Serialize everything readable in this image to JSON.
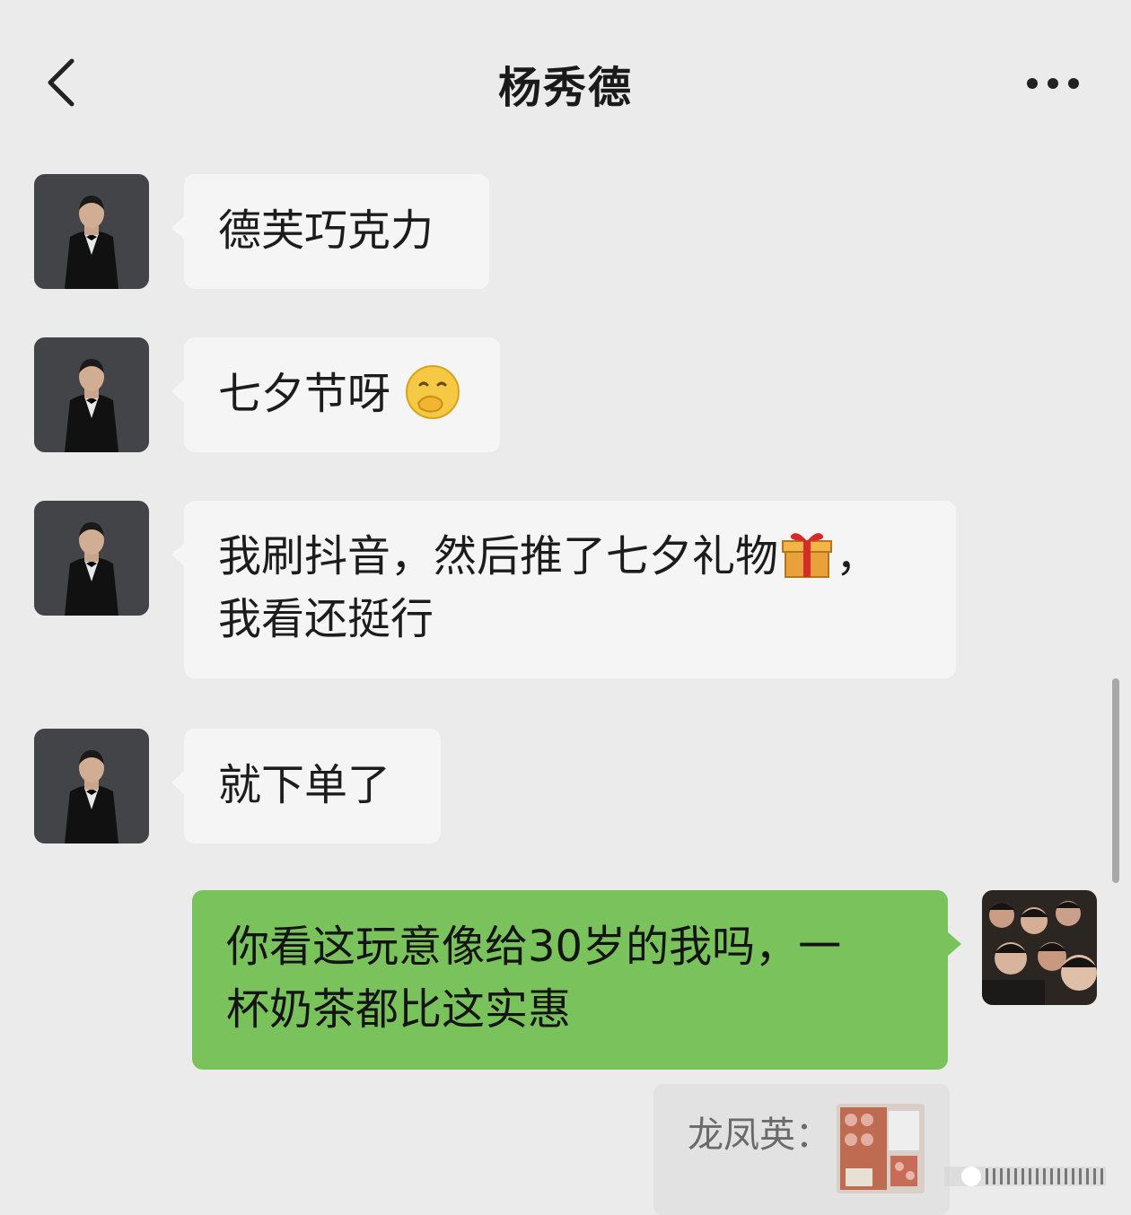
{
  "header": {
    "title": "杨秀德",
    "back_icon": "chevron-left-icon",
    "more_icon": "more-dots-icon"
  },
  "messages": [
    {
      "side": "left",
      "sender_avatar": "avatar-man-tuxedo",
      "text": "德芙巧克力"
    },
    {
      "side": "left",
      "sender_avatar": "avatar-man-tuxedo",
      "text": "七夕节呀",
      "emoji": "covering-mouth-smile-emoji"
    },
    {
      "side": "left",
      "sender_avatar": "avatar-man-tuxedo",
      "line1": "我刷抖音，然后推了七夕礼物",
      "emoji": "gift-emoji",
      "line1_suffix": "，",
      "line2": "我看还挺行"
    },
    {
      "side": "left",
      "sender_avatar": "avatar-man-tuxedo",
      "text": "就下单了"
    },
    {
      "side": "right",
      "sender_avatar": "avatar-group-photo",
      "line1": "你看这玩意像给30岁的我吗，一",
      "line2": "杯奶茶都比这实惠"
    }
  ],
  "quote": {
    "label": "龙凤英：",
    "thumbnail": "chocolate-gift-box-image"
  },
  "colors": {
    "background": "#ebebeb",
    "incoming_bubble": "#f5f5f5",
    "outgoing_bubble": "#79c25c",
    "title_text": "#1a1a1a"
  }
}
